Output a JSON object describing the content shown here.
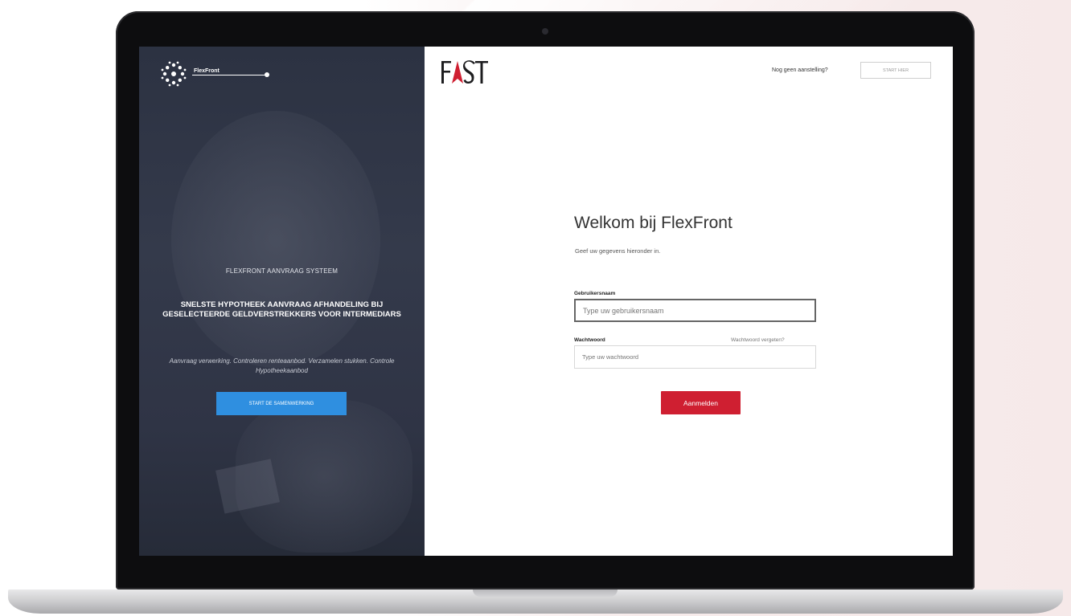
{
  "left_panel": {
    "brand_name": "FlexFront",
    "kicker": "FLEXFRONT AANVRAAG SYSTEEM",
    "headline": "SNELSTE HYPOTHEEK AANVRAAG AFHANDELING BIJ GESELECTEERDE GELDVERSTREKKERS VOOR INTERMEDIARS",
    "subtext": "Aanvraag verwerking. Controleren renteaanbod. Verzamelen stukken. Controle Hypotheekaanbod",
    "cta_label": "START DE SAMENWERKING"
  },
  "right_panel": {
    "logo_text": "FAST",
    "top_question": "Nog geen aanstelling?",
    "top_button": "START HIER",
    "welcome_title": "Welkom bij FlexFront",
    "intro": "Geef uw gegevens hieronder in.",
    "username_label": "Gebruikersnaam",
    "username_placeholder": "Type uw gebruikersnaam",
    "password_label": "Wachtwoord",
    "password_placeholder": "Type uw wachtwoord",
    "forgot_link": "Wachtwoord vergeten?",
    "signin_label": "Aanmelden"
  },
  "colors": {
    "left_panel_bg": "#2f3445",
    "cta_blue": "#2f8fe0",
    "signin_red": "#cf1f31",
    "logo_accent": "#cf1f31"
  }
}
